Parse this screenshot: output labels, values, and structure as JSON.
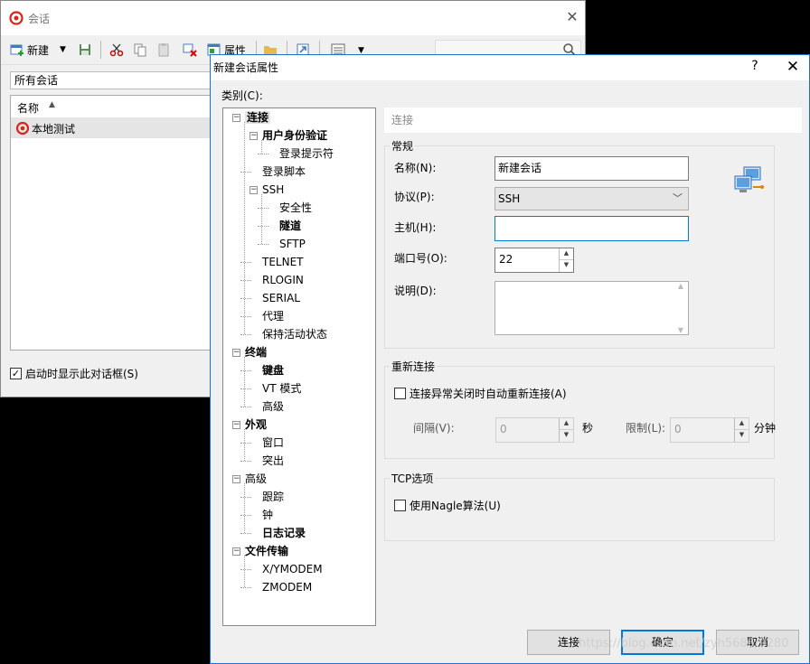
{
  "session_window": {
    "title": "会话",
    "toolbar": {
      "new_label": "新建",
      "properties_label": "属性"
    },
    "folder": "所有会话",
    "list_header": "名称",
    "sessions": [
      "本地测试"
    ],
    "startup_checkbox": "启动时显示此对话框(S)",
    "startup_checked": true
  },
  "dialog": {
    "title": "新建会话属性",
    "help": "?",
    "category_label": "类别(C):",
    "tree": [
      {
        "label": "连接",
        "level": 0,
        "bold": true,
        "expander": "−",
        "selected": true
      },
      {
        "label": "用户身份验证",
        "level": 1,
        "bold": true,
        "expander": "−"
      },
      {
        "label": "登录提示符",
        "level": 2
      },
      {
        "label": "登录脚本",
        "level": 1
      },
      {
        "label": "SSH",
        "level": 1,
        "expander": "−"
      },
      {
        "label": "安全性",
        "level": 2
      },
      {
        "label": "隧道",
        "level": 2,
        "bold": true
      },
      {
        "label": "SFTP",
        "level": 2
      },
      {
        "label": "TELNET",
        "level": 1
      },
      {
        "label": "RLOGIN",
        "level": 1
      },
      {
        "label": "SERIAL",
        "level": 1
      },
      {
        "label": "代理",
        "level": 1
      },
      {
        "label": "保持活动状态",
        "level": 1
      },
      {
        "label": "终端",
        "level": 0,
        "bold": true,
        "expander": "−"
      },
      {
        "label": "键盘",
        "level": 1,
        "bold": true
      },
      {
        "label": "VT 模式",
        "level": 1
      },
      {
        "label": "高级",
        "level": 1
      },
      {
        "label": "外观",
        "level": 0,
        "bold": true,
        "expander": "−"
      },
      {
        "label": "窗口",
        "level": 1
      },
      {
        "label": "突出",
        "level": 1
      },
      {
        "label": "高级",
        "level": 0,
        "expander": "−"
      },
      {
        "label": "跟踪",
        "level": 1
      },
      {
        "label": "钟",
        "level": 1
      },
      {
        "label": "日志记录",
        "level": 1,
        "bold": true
      },
      {
        "label": "文件传输",
        "level": 0,
        "bold": true,
        "expander": "−"
      },
      {
        "label": "X/YMODEM",
        "level": 1
      },
      {
        "label": "ZMODEM",
        "level": 1
      }
    ],
    "page_heading": "连接",
    "general": {
      "title": "常规",
      "name_label": "名称(N):",
      "name_value": "新建会话",
      "protocol_label": "协议(P):",
      "protocol_value": "SSH",
      "host_label": "主机(H):",
      "host_value": "",
      "port_label": "端口号(O):",
      "port_value": "22",
      "desc_label": "说明(D):",
      "desc_value": ""
    },
    "reconnect": {
      "title": "重新连接",
      "checkbox": "连接异常关闭时自动重新连接(A)",
      "checked": false,
      "interval_label": "间隔(V):",
      "interval_value": "0",
      "interval_unit": "秒",
      "limit_label": "限制(L):",
      "limit_value": "0",
      "limit_unit": "分钟"
    },
    "tcp": {
      "title": "TCP选项",
      "checkbox": "使用Nagle算法(U)",
      "checked": false
    },
    "buttons": {
      "connect": "连接",
      "ok": "确定",
      "cancel": "取消"
    }
  },
  "watermark": "https://blog.csdn.net/zyh5686/9280",
  "colors": {
    "accent": "#0078d7",
    "xshell_red": "#d9241c"
  }
}
